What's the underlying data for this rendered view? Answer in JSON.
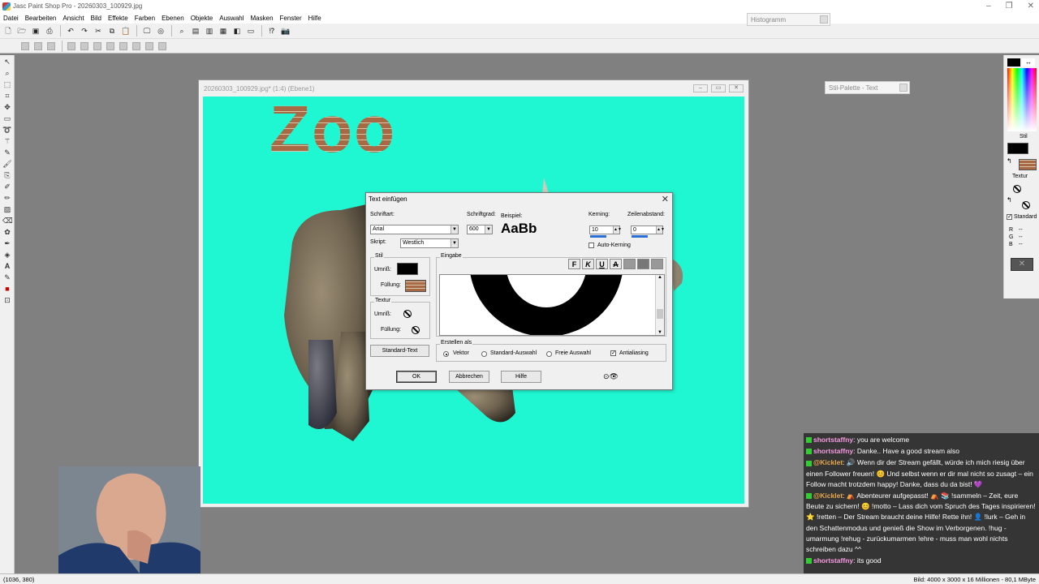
{
  "app": {
    "title": "Jasc Paint Shop Pro - 20260303_100929.jpg",
    "window_controls": [
      "–",
      "❐",
      "✕"
    ]
  },
  "menu": [
    "Datei",
    "Bearbeiten",
    "Ansicht",
    "Bild",
    "Effekte",
    "Farben",
    "Ebenen",
    "Objekte",
    "Auswahl",
    "Masken",
    "Fenster",
    "Hilfe"
  ],
  "palettes": {
    "histogram_title": "Histogramm",
    "style_palette_title": "Stil-Palette - Text"
  },
  "image_window": {
    "title": "20260303_100929.jpg* (1:4) (Ebene1)",
    "canvas_text": "Zoo",
    "canvas_color": "#1ff7d2"
  },
  "color_palette": {
    "stil_label": "Stil",
    "textur_label": "Textur",
    "standard_label": "Standard",
    "r": "R",
    "g": "G",
    "b": "B",
    "dashes": "--"
  },
  "dialog": {
    "title": "Text einfügen",
    "font_label": "Schriftart:",
    "font_value": "Arial",
    "script_label": "Skript:",
    "script_value": "Westlich",
    "size_label": "Schriftgrad:",
    "size_value": "600",
    "example_label": "Beispiel:",
    "example_text": "AaBb",
    "kerning_label": "Kerning:",
    "kerning_value": "10",
    "line_spacing_label": "Zeilenabstand:",
    "line_spacing_value": "0",
    "auto_kerning_label": "Auto-Kerning",
    "stil_group": "Stil",
    "umriss_label": "Umriß:",
    "fuellung_label": "Füllung:",
    "textur_group": "Textur",
    "standard_text_button": "Standard-Text",
    "eingabe_group": "Eingabe",
    "format_buttons": [
      "F",
      "K",
      "U",
      "A"
    ],
    "erstellen_group": "Erstellen als",
    "radio_vektor": "Vektor",
    "radio_standard_auswahl": "Standard-Auswahl",
    "radio_freie_auswahl": "Freie Auswahl",
    "antialiasing_label": "Antialiasing",
    "ok_button": "OK",
    "cancel_button": "Abbrechen",
    "help_button": "Hilfe",
    "close": "✕"
  },
  "chat": [
    {
      "user": "shortstaffny",
      "text": ": you are welcome",
      "cls": ""
    },
    {
      "user": "shortstaffny",
      "text": ": Danke.. Have a good stream also",
      "cls": ""
    },
    {
      "user": "@Kicklet",
      "text": ": 🔊 Wenn dir der Stream gefällt, würde ich mich riesig über einen Follower freuen! 😊 Und selbst wenn er dir mal nicht so zusagt – ein Follow macht trotzdem happy! Danke, dass du da bist! 💜",
      "cls": "k"
    },
    {
      "user": "@Kicklet",
      "text": ": ⛺ Abenteurer aufgepasst! ⛺ 📚 !sammeln – Zeit, eure Beute zu sichern! 😊 !motto – Lass dich vom Spruch des Tages inspirieren! ⭐ !retten – Der Stream braucht deine Hilfe! Rette ihn! 👤 !lurk – Geh in den Schattenmodus und genieß die Show im Verborgenen. !hug - umarmung !rehug - zurückumarmen !ehre - muss man wohl nichts schreiben dazu ^^",
      "cls": "k"
    },
    {
      "user": "shortstaffny",
      "text": ": its good",
      "cls": ""
    }
  ],
  "status": {
    "coords": "(1036, 380)",
    "image_info": "Bild: 4000 x 3000 x 16 Millionen - 80,1 MByte"
  }
}
